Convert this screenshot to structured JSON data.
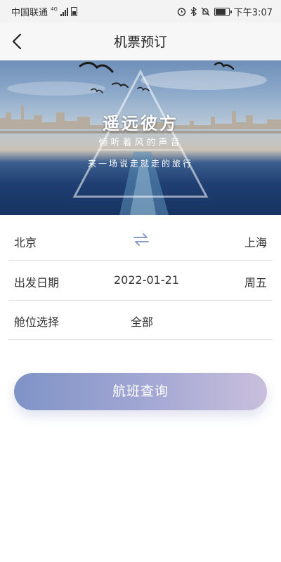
{
  "status_bar": {
    "carrier": "中国联通",
    "network": "4G",
    "time": "下午3:07"
  },
  "nav": {
    "title": "机票预订",
    "back_icon": "chevron-left-icon"
  },
  "banner": {
    "title": "遥远彼方",
    "subtitle": "倾听着风的声音",
    "tagline": "来一场说走就走的旅行"
  },
  "route": {
    "from_city": "北京",
    "to_city": "上海",
    "swap_icon": "swap-arrows-icon"
  },
  "departure": {
    "label": "出发日期",
    "date": "2022-01-21",
    "weekday": "周五"
  },
  "cabin": {
    "label": "舱位选择",
    "value": "全部"
  },
  "search_button": {
    "label": "航班查询"
  },
  "colors": {
    "button_start": "#7f93c6",
    "button_end": "#c9bfdc",
    "swap_icon": "#8a9cc8",
    "divider": "#dddddd"
  }
}
